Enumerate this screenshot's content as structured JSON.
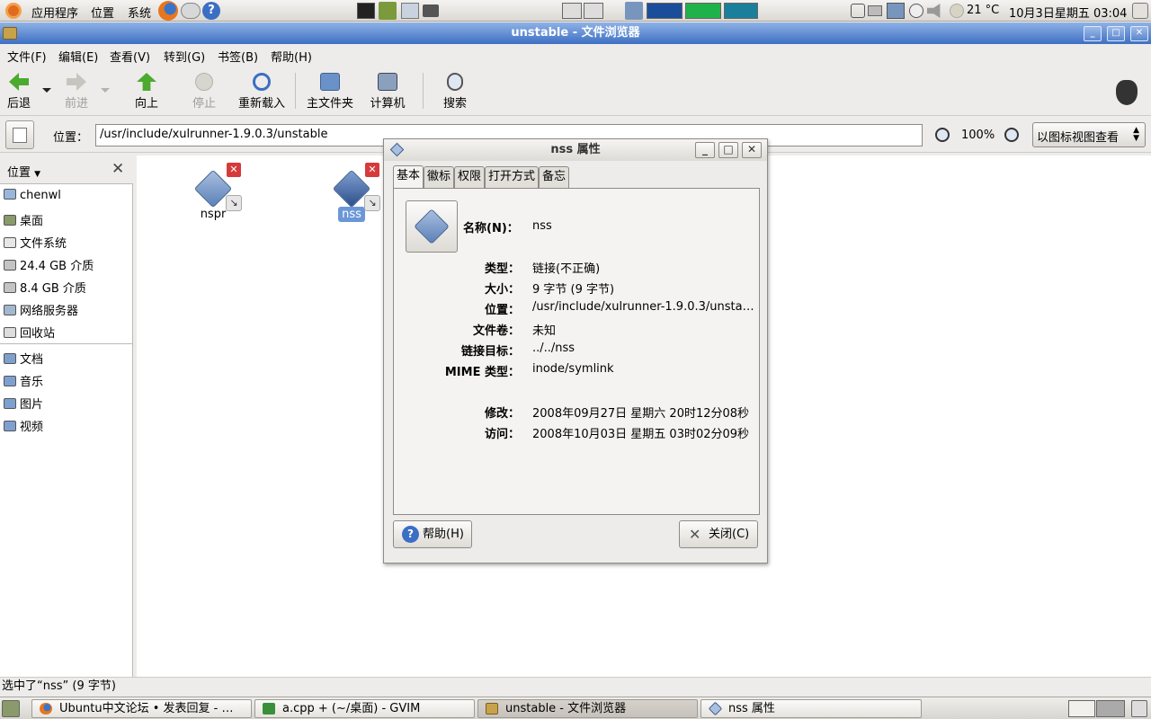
{
  "top_panel": {
    "menus": [
      "应用程序",
      "位置",
      "系统"
    ],
    "temperature": "21 °C",
    "datetime": "10月3日星期五 03:04"
  },
  "window": {
    "title": "unstable - 文件浏览器",
    "menu": [
      "文件(F)",
      "编辑(E)",
      "查看(V)",
      "转到(G)",
      "书签(B)",
      "帮助(H)"
    ],
    "toolbar": {
      "back": "后退",
      "forward": "前进",
      "up": "向上",
      "stop": "停止",
      "reload": "重新载入",
      "home": "主文件夹",
      "computer": "计算机",
      "search": "搜索"
    },
    "location": {
      "label": "位置：",
      "path": "/usr/include/xulrunner-1.9.0.3/unstable",
      "zoom": "100%",
      "view_mode": "以图标视图查看"
    },
    "sidebar": {
      "header": "位置",
      "places": [
        "chenwl",
        "桌面",
        "文件系统",
        "24.4 GB 介质",
        "8.4 GB 介质",
        "网络服务器",
        "回收站"
      ],
      "bookmarks": [
        "文档",
        "音乐",
        "图片",
        "视频"
      ]
    },
    "files": [
      {
        "name": "nspr",
        "selected": false
      },
      {
        "name": "nss",
        "selected": true
      }
    ],
    "status": "选中了“nss” (9 字节)"
  },
  "dialog": {
    "title": "nss 属性",
    "tabs": [
      "基本",
      "徽标",
      "权限",
      "打开方式",
      "备忘"
    ],
    "name_label": "名称(N)：",
    "name_value": "nss",
    "rows": [
      {
        "label": "类型：",
        "value": "链接(不正确)"
      },
      {
        "label": "大小：",
        "value": "9 字节 (9 字节)"
      },
      {
        "label": "位置：",
        "value": "/usr/include/xulrunner-1.9.0.3/unsta…"
      },
      {
        "label": "文件卷：",
        "value": "未知"
      },
      {
        "label": "链接目标：",
        "value": "../../nss"
      },
      {
        "label": "MIME 类型：",
        "value": "inode/symlink"
      },
      {
        "label": "修改：",
        "value": "2008年09月27日 星期六 20时12分08秒"
      },
      {
        "label": "访问：",
        "value": "2008年10月03日 星期五 03时02分09秒"
      }
    ],
    "help_button": "帮助(H)",
    "close_button": "关闭(C)"
  },
  "taskbar": [
    {
      "label": "Ubuntu中文论坛 • 发表回复 - …",
      "active": false
    },
    {
      "label": "a.cpp + (~/桌面) - GVIM",
      "active": false
    },
    {
      "label": "unstable - 文件浏览器",
      "active": true
    },
    {
      "label": "nss 属性",
      "active": false
    }
  ],
  "colors": {
    "titlebar": "#5a86cf",
    "selection": "#6b97d8",
    "icon_blue": "#5b80b8",
    "error_red": "#d63a3a",
    "monitor_green": "#1fb24a"
  }
}
